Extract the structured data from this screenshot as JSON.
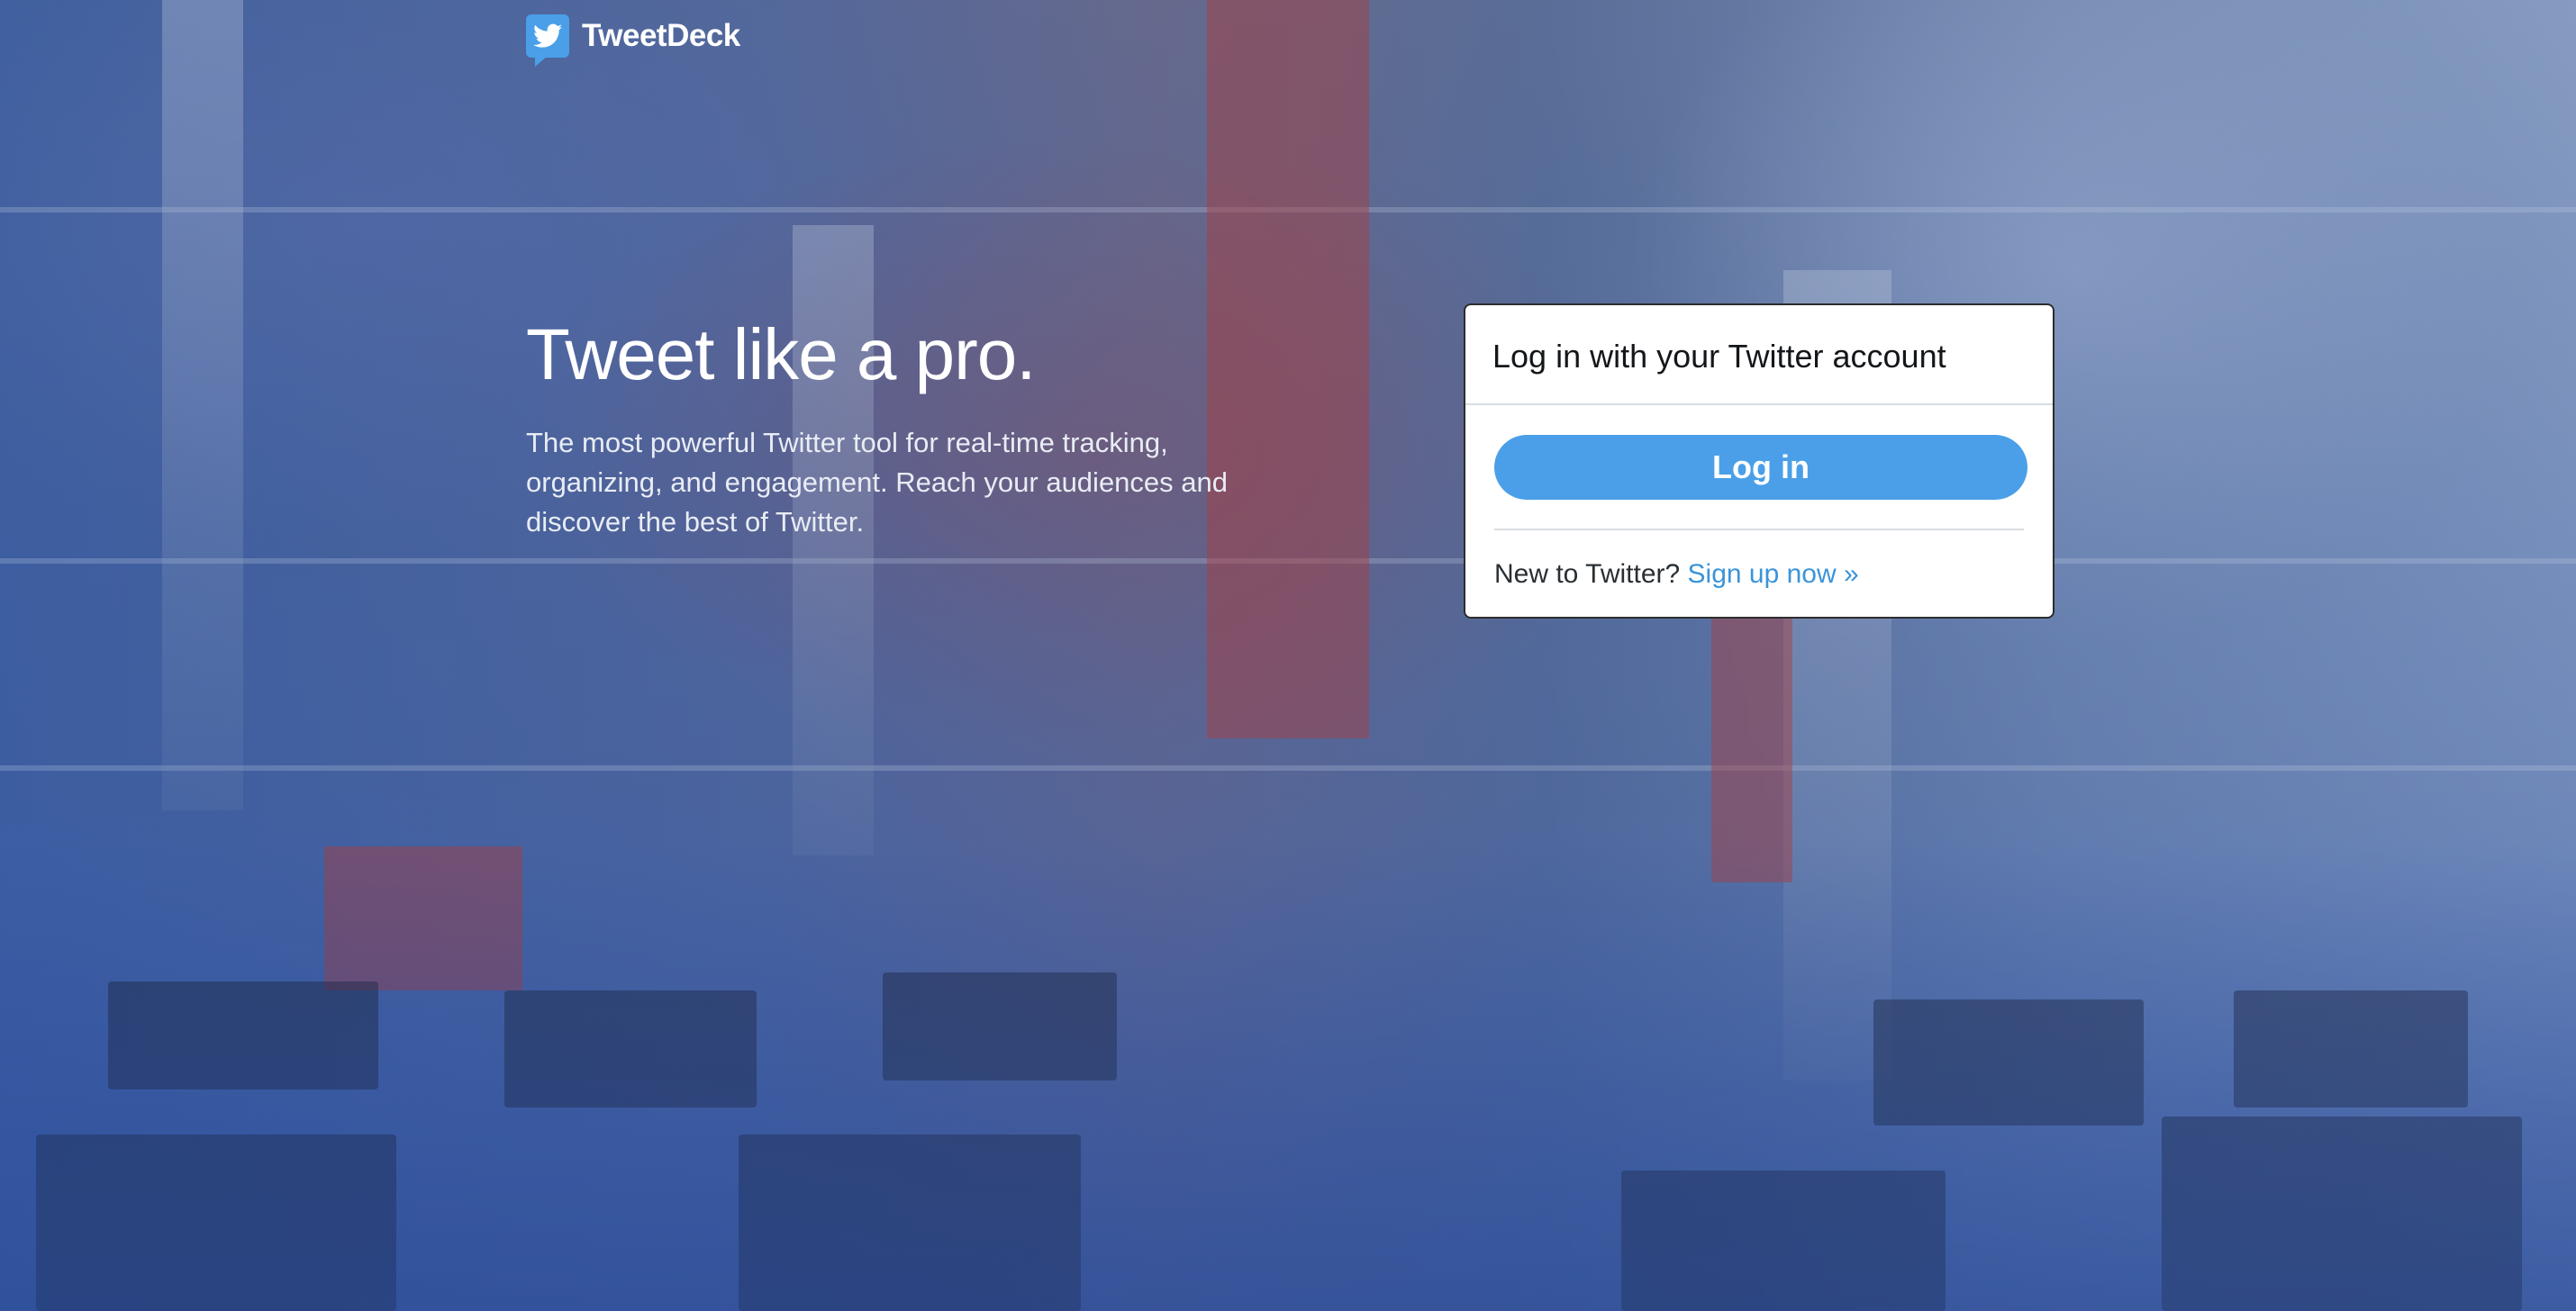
{
  "header": {
    "logo_text": "TweetDeck",
    "logo_icon": "twitter-bird-icon"
  },
  "hero": {
    "title": "Tweet like a pro.",
    "description": "The most powerful Twitter tool for real-time tracking, organizing, and engagement. Reach your audiences and discover the best of Twitter."
  },
  "login_card": {
    "title": "Log in with your Twitter account",
    "login_button_label": "Log in",
    "signup_prompt": "New to Twitter?",
    "signup_link_label": "Sign up now »"
  },
  "colors": {
    "accent": "#4a9fe8",
    "link": "#3b94d9"
  }
}
